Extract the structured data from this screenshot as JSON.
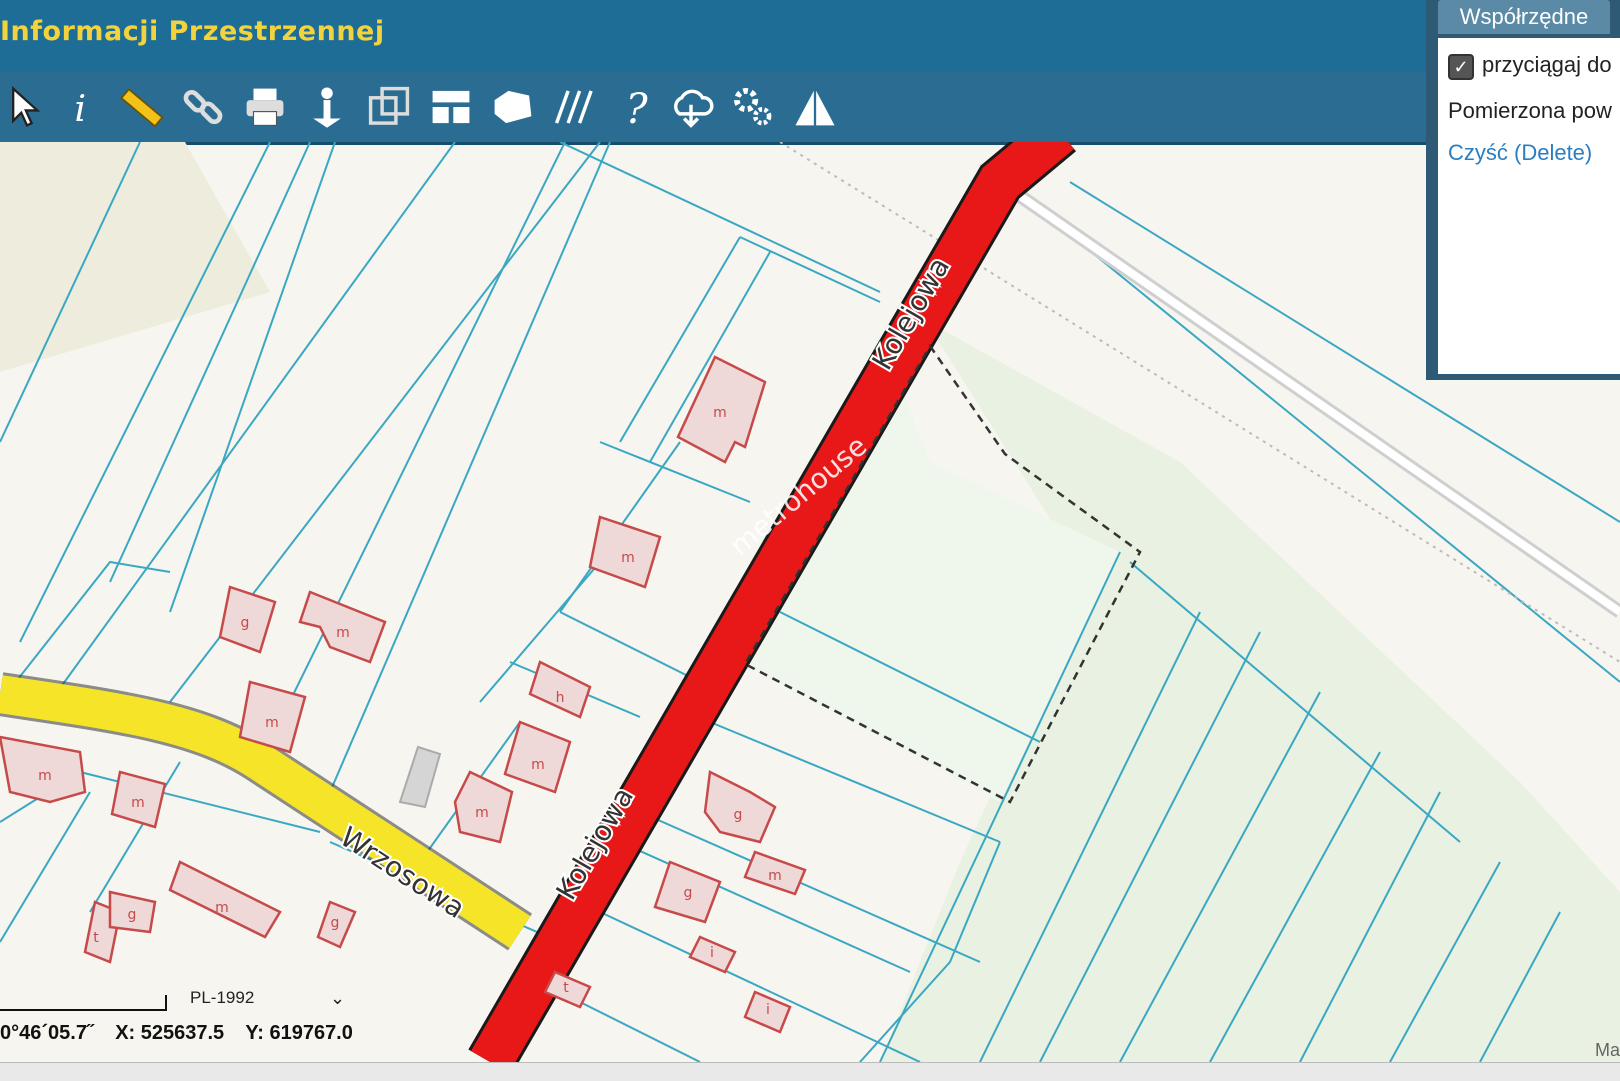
{
  "header": {
    "title": "Informacji Przestrzennej"
  },
  "toolbar": {
    "tools": [
      "pointer-icon",
      "info-icon",
      "ruler-icon",
      "link-icon",
      "print-icon",
      "identify-icon",
      "copy-icon",
      "layout-icon",
      "area-icon",
      "hatch-icon",
      "help-icon",
      "cloud-download-icon",
      "settings-icon",
      "warning-icon"
    ]
  },
  "panel": {
    "tab": "Współrzędne",
    "snap_label": "przyciągaj do",
    "measured_label": "Pomierzona pow",
    "clear_label": "Czyść (Delete)"
  },
  "map": {
    "streets": {
      "kolejowa": "Kolejowa",
      "wrzosowa": "Wrzosowa"
    },
    "watermark": "metrohouse",
    "building_labels": [
      "m",
      "m",
      "g",
      "m",
      "m",
      "h",
      "m",
      "m",
      "m",
      "m",
      "m",
      "g",
      "m",
      "g",
      "t",
      "g",
      "g",
      "i",
      "t",
      "i"
    ]
  },
  "status": {
    "crs": "PL-1992",
    "lon": "0°46´05.7˝",
    "x": "X: 525637.5",
    "y": "Y: 619767.0",
    "attribution": "Ma"
  },
  "colors": {
    "header": "#1e6d97",
    "title": "#f2d33c",
    "parcel_line": "#3aa7c3",
    "road_main": "#e81818",
    "road_secondary": "#f5e427",
    "building": "#c64a4a"
  }
}
